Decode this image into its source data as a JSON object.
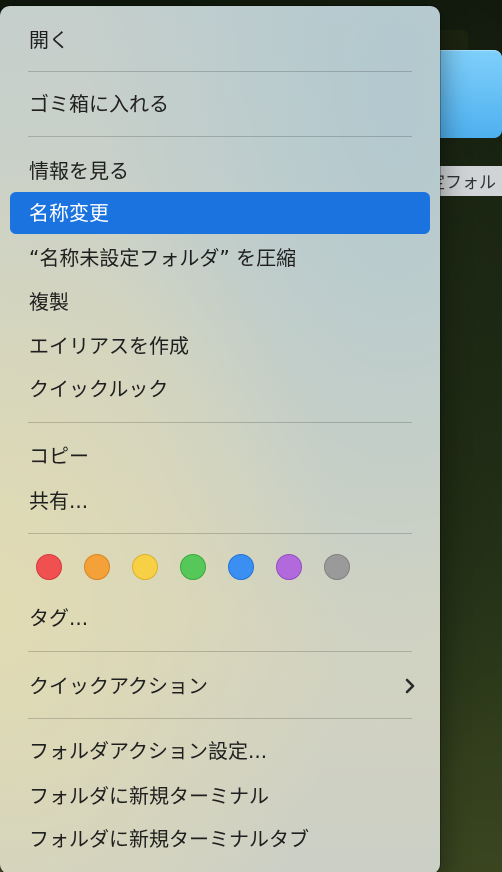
{
  "desktop": {
    "folder_label": "定フォル"
  },
  "menu": {
    "items": {
      "open": "開く",
      "trash": "ゴミ箱に入れる",
      "get_info": "情報を見る",
      "rename": "名称変更",
      "compress": "“名称未設定フォルダ” を圧縮",
      "duplicate": "複製",
      "make_alias": "エイリアスを作成",
      "quick_look": "クイックルック",
      "copy": "コピー",
      "share": "共有...",
      "tags": "タグ...",
      "quick_actions": "クイックアクション",
      "folder_actions": "フォルダアクション設定...",
      "new_terminal": "フォルダに新規ターミナル",
      "new_terminal_tab": "フォルダに新規ターミナルタブ"
    },
    "selected": "rename",
    "submenu_icon": "chevron-right-icon",
    "tag_colors": [
      {
        "name": "red",
        "fill": "#f0504f",
        "border": "#d43a3a"
      },
      {
        "name": "orange",
        "fill": "#f4a13a",
        "border": "#d98420"
      },
      {
        "name": "yellow",
        "fill": "#f8d046",
        "border": "#dbb12a"
      },
      {
        "name": "green",
        "fill": "#56c85a",
        "border": "#3aa83e"
      },
      {
        "name": "blue",
        "fill": "#3b8ff3",
        "border": "#2373d6"
      },
      {
        "name": "purple",
        "fill": "#b169dc",
        "border": "#954cc0"
      },
      {
        "name": "gray",
        "fill": "#9a9a9a",
        "border": "#808080"
      }
    ]
  }
}
